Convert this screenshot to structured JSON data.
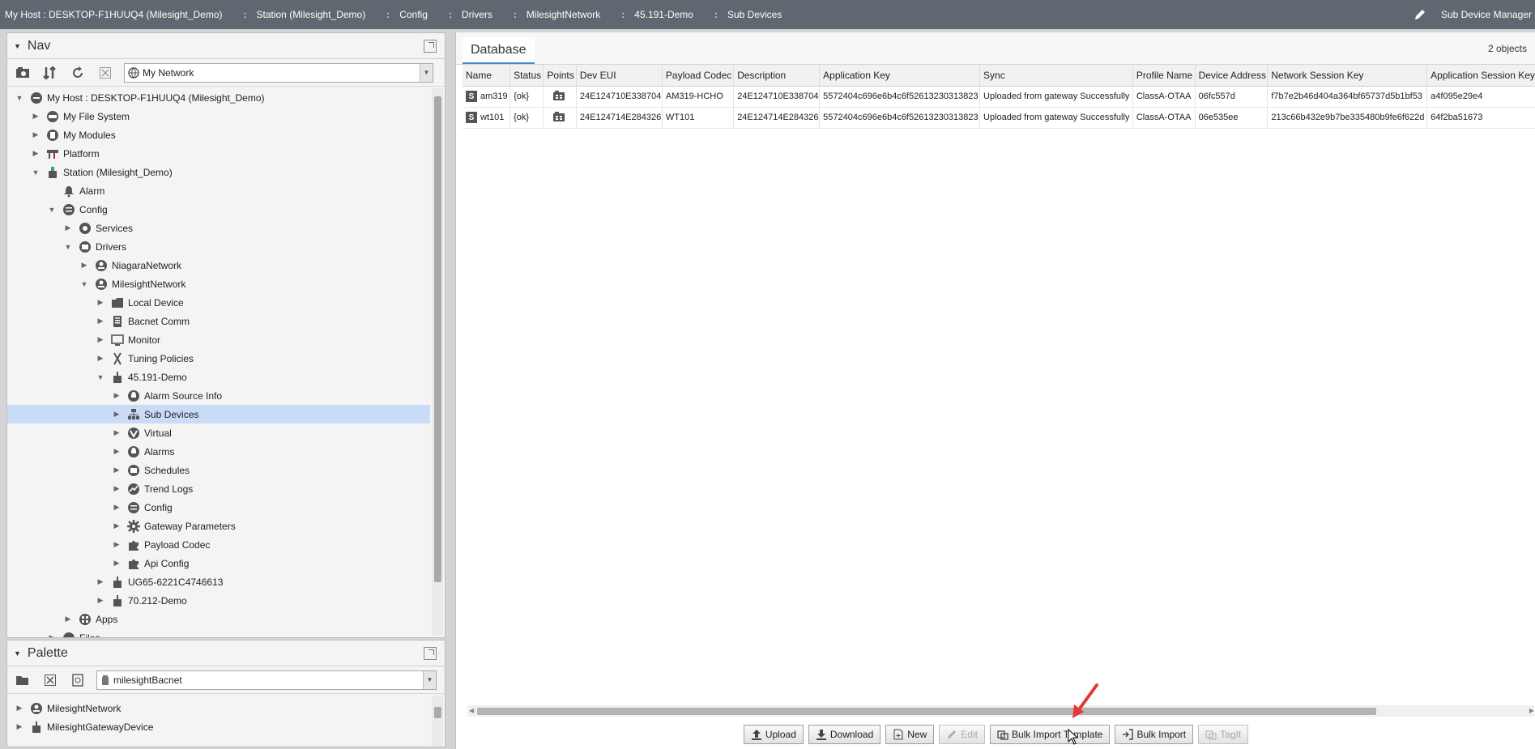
{
  "breadcrumb": [
    {
      "label": "My Host : DESKTOP-F1HUUQ4 (Milesight_Demo)"
    },
    {
      "label": "Station (Milesight_Demo)"
    },
    {
      "label": "Config"
    },
    {
      "label": "Drivers"
    },
    {
      "label": "MilesightNetwork"
    },
    {
      "label": "45.191-Demo"
    },
    {
      "label": "Sub Devices"
    }
  ],
  "view_selector": {
    "label": "Sub Device Manager"
  },
  "nav": {
    "title": "Nav",
    "root_selector": "My Network",
    "tree": [
      {
        "label": "My Host : DESKTOP-F1HUUQ4 (Milesight_Demo)",
        "icon": "host-icon",
        "expanded": true
      },
      {
        "label": "My File System",
        "icon": "disk-icon"
      },
      {
        "label": "My Modules",
        "icon": "modules-icon"
      },
      {
        "label": "Platform",
        "icon": "platform-icon"
      },
      {
        "label": "Station (Milesight_Demo)",
        "icon": "station-icon",
        "expanded": true
      },
      {
        "label": "Alarm",
        "icon": "bell-icon"
      },
      {
        "label": "Config",
        "icon": "config-icon",
        "expanded": true
      },
      {
        "label": "Services",
        "icon": "services-icon"
      },
      {
        "label": "Drivers",
        "icon": "drivers-icon",
        "expanded": true
      },
      {
        "label": "NiagaraNetwork",
        "icon": "network-icon"
      },
      {
        "label": "MilesightNetwork",
        "icon": "network-icon",
        "expanded": true
      },
      {
        "label": "Local Device",
        "icon": "folder-icon"
      },
      {
        "label": "Bacnet Comm",
        "icon": "comm-icon"
      },
      {
        "label": "Monitor",
        "icon": "monitor-icon"
      },
      {
        "label": "Tuning Policies",
        "icon": "tuning-icon"
      },
      {
        "label": "45.191-Demo",
        "icon": "gateway-icon",
        "expanded": true
      },
      {
        "label": "Alarm Source Info",
        "icon": "alarm-source-icon"
      },
      {
        "label": "Sub Devices",
        "icon": "sub-devices-icon",
        "selected": true
      },
      {
        "label": "Virtual",
        "icon": "virtual-icon"
      },
      {
        "label": "Alarms",
        "icon": "alarms-icon"
      },
      {
        "label": "Schedules",
        "icon": "schedules-icon"
      },
      {
        "label": "Trend Logs",
        "icon": "trend-icon"
      },
      {
        "label": "Config",
        "icon": "config-icon"
      },
      {
        "label": "Gateway Parameters",
        "icon": "gear-icon"
      },
      {
        "label": "Payload Codec",
        "icon": "puzzle-icon"
      },
      {
        "label": "Api Config",
        "icon": "puzzle-icon"
      },
      {
        "label": "UG65-6221C4746613",
        "icon": "gateway-icon"
      },
      {
        "label": "70.212-Demo",
        "icon": "gateway-icon"
      },
      {
        "label": "Apps",
        "icon": "apps-icon"
      },
      {
        "label": "Files",
        "icon": "files-icon"
      }
    ]
  },
  "palette": {
    "title": "Palette",
    "module_selector": "milesightBacnet",
    "items": [
      {
        "label": "MilesightNetwork",
        "icon": "network-icon"
      },
      {
        "label": "MilesightGatewayDevice",
        "icon": "gateway-icon"
      }
    ]
  },
  "database": {
    "tab_label": "Database",
    "object_count": "2 objects",
    "columns": [
      "Name",
      "Status",
      "Points",
      "Dev EUI",
      "Payload Codec",
      "Description",
      "Application Key",
      "Sync",
      "Profile Name",
      "Device Address",
      "Network Session Key",
      "Application Session Key"
    ],
    "rows": [
      {
        "name": "am319",
        "status": "{ok}",
        "dev_eui": "24E124710E338704",
        "payload_codec": "AM319-HCHO",
        "description": "24E124710E338704",
        "app_key": "5572404c696e6b4c6f52613230313823",
        "sync": "Uploaded from gateway Successfully",
        "profile": "ClassA-OTAA",
        "dev_addr": "06fc557d",
        "nwk_skey": "f7b7e2b46d404a364bf65737d5b1bf53",
        "app_skey": "a4f095e29e4"
      },
      {
        "name": "wt101",
        "status": "{ok}",
        "dev_eui": "24E124714E284326",
        "payload_codec": "WT101",
        "description": "24E124714E284326",
        "app_key": "5572404c696e6b4c6f52613230313823",
        "sync": "Uploaded from gateway Successfully",
        "profile": "ClassA-OTAA",
        "dev_addr": "06e535ee",
        "nwk_skey": "213c66b432e9b7be335480b9fe6f622d",
        "app_skey": "64f2ba51673"
      }
    ]
  },
  "actions": [
    {
      "label": "Upload",
      "icon": "upload-icon",
      "enabled": true
    },
    {
      "label": "Download",
      "icon": "download-icon",
      "enabled": true
    },
    {
      "label": "New",
      "icon": "new-icon",
      "enabled": true
    },
    {
      "label": "Edit",
      "icon": "edit-icon",
      "enabled": false
    },
    {
      "label": "Bulk Import Template",
      "icon": "template-icon",
      "enabled": true
    },
    {
      "label": "Bulk Import",
      "icon": "import-icon",
      "enabled": true
    },
    {
      "label": "TagIt",
      "icon": "tag-icon",
      "enabled": false
    }
  ],
  "colors": {
    "topbar": "#5f6770",
    "selection": "#c9dcf7",
    "annotation_arrow": "#e53935"
  }
}
